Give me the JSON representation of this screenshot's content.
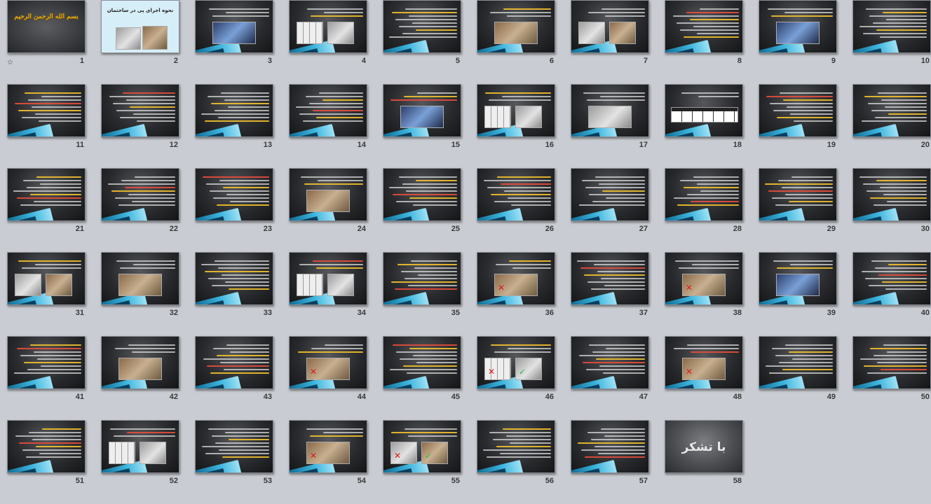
{
  "slides": [
    {
      "number": "1",
      "kind": "title",
      "title": "",
      "marked": true
    },
    {
      "number": "2",
      "kind": "cover",
      "title": "نحوه اجرای پی در ساختمان"
    },
    {
      "number": "3",
      "kind": "text-pic",
      "title": ""
    },
    {
      "number": "4",
      "kind": "text-pic",
      "title": ""
    },
    {
      "number": "5",
      "kind": "text",
      "title": ""
    },
    {
      "number": "6",
      "kind": "text-pic",
      "title": ""
    },
    {
      "number": "7",
      "kind": "text-pic",
      "title": ""
    },
    {
      "number": "8",
      "kind": "text",
      "title": ""
    },
    {
      "number": "9",
      "kind": "text-pic",
      "title": ""
    },
    {
      "number": "10",
      "kind": "text",
      "title": ""
    },
    {
      "number": "11",
      "kind": "text",
      "title": ""
    },
    {
      "number": "12",
      "kind": "text",
      "title": ""
    },
    {
      "number": "13",
      "kind": "text",
      "title": ""
    },
    {
      "number": "14",
      "kind": "text",
      "title": ""
    },
    {
      "number": "15",
      "kind": "text-pic",
      "title": ""
    },
    {
      "number": "16",
      "kind": "text-pic",
      "title": ""
    },
    {
      "number": "17",
      "kind": "text-pic",
      "title": ""
    },
    {
      "number": "18",
      "kind": "table",
      "title": ""
    },
    {
      "number": "19",
      "kind": "text",
      "title": ""
    },
    {
      "number": "20",
      "kind": "text",
      "title": ""
    },
    {
      "number": "21",
      "kind": "text",
      "title": ""
    },
    {
      "number": "22",
      "kind": "text",
      "title": ""
    },
    {
      "number": "23",
      "kind": "text",
      "title": ""
    },
    {
      "number": "24",
      "kind": "text-pic",
      "title": ""
    },
    {
      "number": "25",
      "kind": "text",
      "title": ""
    },
    {
      "number": "26",
      "kind": "text",
      "title": ""
    },
    {
      "number": "27",
      "kind": "text",
      "title": ""
    },
    {
      "number": "28",
      "kind": "text",
      "title": ""
    },
    {
      "number": "29",
      "kind": "text",
      "title": ""
    },
    {
      "number": "30",
      "kind": "text",
      "title": ""
    },
    {
      "number": "31",
      "kind": "text-pic",
      "title": ""
    },
    {
      "number": "32",
      "kind": "text-pic",
      "title": ""
    },
    {
      "number": "33",
      "kind": "text",
      "title": ""
    },
    {
      "number": "34",
      "kind": "text-pic",
      "title": ""
    },
    {
      "number": "35",
      "kind": "text",
      "title": ""
    },
    {
      "number": "36",
      "kind": "text-pic",
      "title": ""
    },
    {
      "number": "37",
      "kind": "text",
      "title": ""
    },
    {
      "number": "38",
      "kind": "text-pic",
      "title": ""
    },
    {
      "number": "39",
      "kind": "text-pic",
      "title": ""
    },
    {
      "number": "40",
      "kind": "text",
      "title": ""
    },
    {
      "number": "41",
      "kind": "text",
      "title": ""
    },
    {
      "number": "42",
      "kind": "text-pic",
      "title": ""
    },
    {
      "number": "43",
      "kind": "text",
      "title": ""
    },
    {
      "number": "44",
      "kind": "text-pic",
      "title": ""
    },
    {
      "number": "45",
      "kind": "text",
      "title": ""
    },
    {
      "number": "46",
      "kind": "text-pic",
      "title": ""
    },
    {
      "number": "47",
      "kind": "text",
      "title": ""
    },
    {
      "number": "48",
      "kind": "text-pic",
      "title": ""
    },
    {
      "number": "49",
      "kind": "text",
      "title": ""
    },
    {
      "number": "50",
      "kind": "text",
      "title": ""
    },
    {
      "number": "51",
      "kind": "text",
      "title": ""
    },
    {
      "number": "52",
      "kind": "text-pic",
      "title": ""
    },
    {
      "number": "53",
      "kind": "text",
      "title": ""
    },
    {
      "number": "54",
      "kind": "text-pic",
      "title": ""
    },
    {
      "number": "55",
      "kind": "text-pic",
      "title": ""
    },
    {
      "number": "56",
      "kind": "text",
      "title": ""
    },
    {
      "number": "57",
      "kind": "text",
      "title": ""
    },
    {
      "number": "58",
      "kind": "thanks",
      "title": "با تشکر"
    }
  ],
  "marker_icon": "star-outline-icon",
  "marker_glyph": "☆"
}
